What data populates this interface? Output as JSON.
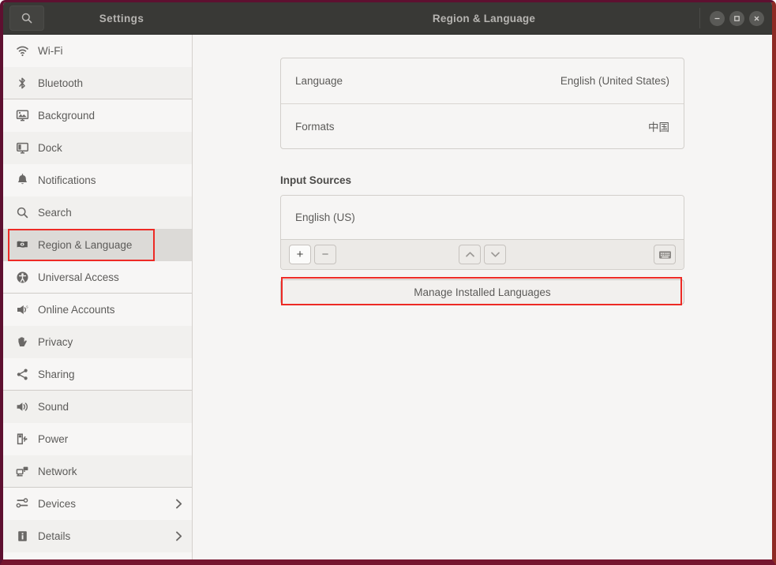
{
  "window": {
    "app_label": "Settings",
    "title": "Region & Language",
    "search_icon": "search-icon",
    "controls": [
      {
        "name": "minimize",
        "icon": "minimize-icon"
      },
      {
        "name": "maximize",
        "icon": "maximize-icon"
      },
      {
        "name": "close",
        "icon": "close-icon"
      }
    ],
    "frame_color": "#76152f"
  },
  "sidebar": {
    "items": [
      {
        "label": "Wi-Fi",
        "icon": "wifi-icon",
        "selected": false,
        "chevron": false
      },
      {
        "label": "Bluetooth",
        "icon": "bluetooth-icon",
        "selected": false,
        "chevron": false
      },
      {
        "label": "Background",
        "icon": "background-icon",
        "selected": false,
        "chevron": false
      },
      {
        "label": "Dock",
        "icon": "dock-icon",
        "selected": false,
        "chevron": false
      },
      {
        "label": "Notifications",
        "icon": "bell-icon",
        "selected": false,
        "chevron": false
      },
      {
        "label": "Search",
        "icon": "search-icon",
        "selected": false,
        "chevron": false
      },
      {
        "label": "Region & Language",
        "icon": "flag-icon",
        "selected": true,
        "chevron": false
      },
      {
        "label": "Universal Access",
        "icon": "accessibility-icon",
        "selected": false,
        "chevron": false
      },
      {
        "label": "Online Accounts",
        "icon": "online-accounts-icon",
        "selected": false,
        "chevron": false
      },
      {
        "label": "Privacy",
        "icon": "hand-icon",
        "selected": false,
        "chevron": false
      },
      {
        "label": "Sharing",
        "icon": "share-icon",
        "selected": false,
        "chevron": false
      },
      {
        "label": "Sound",
        "icon": "speaker-icon",
        "selected": false,
        "chevron": false
      },
      {
        "label": "Power",
        "icon": "power-icon",
        "selected": false,
        "chevron": false
      },
      {
        "label": "Network",
        "icon": "network-icon",
        "selected": false,
        "chevron": false
      },
      {
        "label": "Devices",
        "icon": "devices-icon",
        "selected": false,
        "chevron": true
      },
      {
        "label": "Details",
        "icon": "info-icon",
        "selected": false,
        "chevron": true
      }
    ],
    "highlight_color": "#ed2a25"
  },
  "main": {
    "language_card": {
      "rows": [
        {
          "label": "Language",
          "value": "English (United States)"
        },
        {
          "label": "Formats",
          "value": "中国"
        }
      ]
    },
    "input_sources": {
      "section_title": "Input Sources",
      "sources": [
        "English (US)"
      ],
      "toolbar": {
        "add_label": "+",
        "remove_label": "−",
        "move_up_icon": "chevron-up-icon",
        "move_down_icon": "chevron-down-icon",
        "keyboard_icon": "keyboard-icon"
      }
    },
    "manage_button": {
      "label": "Manage Installed Languages",
      "highlighted": true,
      "highlight_color": "#ed2a25"
    }
  }
}
